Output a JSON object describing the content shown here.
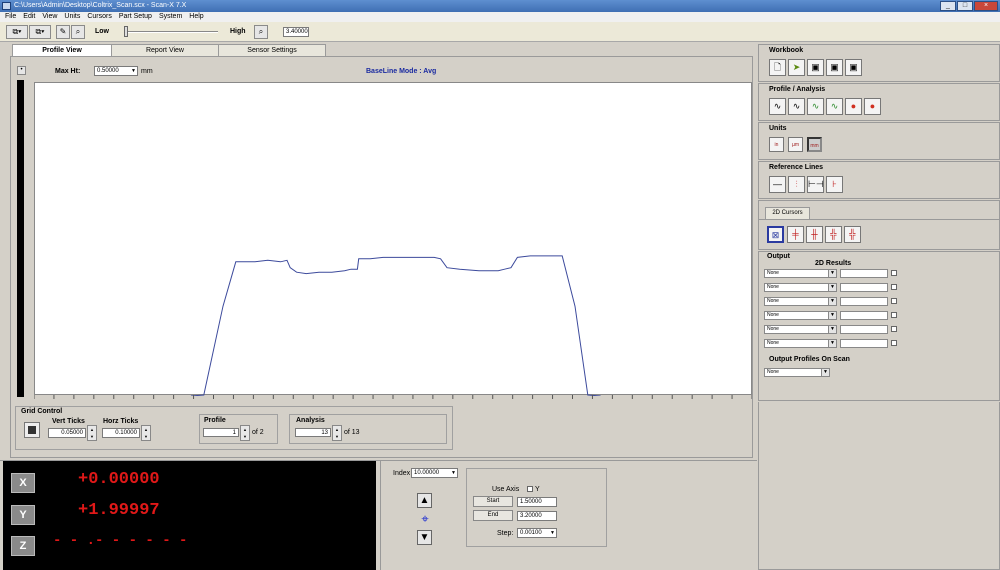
{
  "window": {
    "title": "C:\\Users\\Admin\\Desktop\\Coltrix_Scan.scx - Scan-X 7.X"
  },
  "menu": [
    "File",
    "Edit",
    "View",
    "Units",
    "Cursors",
    "Part Setup",
    "System",
    "Help"
  ],
  "toolbar": {
    "low_label": "Low",
    "high_label": "High",
    "value": "3.40000"
  },
  "tabs": [
    "Profile View",
    "Report View",
    "Sensor Settings"
  ],
  "plot_header": {
    "max_ht_label": "Max Ht:",
    "max_ht_value": "0.50000",
    "max_ht_unit": "mm",
    "baseline_mode": "BaseLine Mode : Avg"
  },
  "grid_control": {
    "title": "Grid Control",
    "vert_label": "Vert Ticks",
    "vert_value": "0.05000",
    "horz_label": "Horz Ticks",
    "horz_value": "0.10000",
    "profile_label": "Profile",
    "profile_value": "1",
    "profile_of": "of 2",
    "analysis_label": "Analysis",
    "analysis_value": "13",
    "analysis_of": "of 13"
  },
  "dro": {
    "x_label": "X",
    "x_value": "+0.00000",
    "y_label": "Y",
    "y_value": "+1.99997",
    "z_label": "Z",
    "z_value": "- - .- - - - - -"
  },
  "index_panel": {
    "index_label": "Index",
    "index_value": "10.00000",
    "use_axis_label": "Use Axis",
    "use_axis_value": "Y",
    "start_label": "Start",
    "start_value": "1.50000",
    "end_label": "End",
    "end_value": "3.20000",
    "step_label": "Step:",
    "step_value": "0.00100"
  },
  "right": {
    "workbook": "Workbook",
    "profile_analysis": "Profile / Analysis",
    "units": "Units",
    "units_buttons": [
      "in",
      "µm",
      "mm"
    ],
    "reference_lines": "Reference Lines",
    "cursors_tab": "2D Cursors",
    "output": "Output",
    "results_title": "2D Results",
    "output_rows": [
      "None",
      "None",
      "None",
      "None",
      "None",
      "None"
    ],
    "output_profiles_label": "Output Profiles On Scan",
    "output_profiles_value": "None"
  },
  "chart_data": {
    "type": "line",
    "series": [
      {
        "values": [
          [
            0.0,
            0.0
          ],
          [
            0.02,
            0.0
          ],
          [
            0.05,
            0.6
          ],
          [
            0.07,
            0.9
          ],
          [
            0.1,
            0.9
          ],
          [
            0.12,
            0.91
          ],
          [
            0.14,
            0.9
          ],
          [
            0.15,
            0.91
          ],
          [
            0.155,
            0.86
          ],
          [
            0.165,
            0.83
          ],
          [
            0.18,
            0.82
          ],
          [
            0.2,
            0.83
          ],
          [
            0.22,
            0.83
          ],
          [
            0.24,
            0.84
          ],
          [
            0.25,
            0.85
          ],
          [
            0.26,
            0.85
          ],
          [
            0.262,
            0.92
          ],
          [
            0.28,
            0.92
          ],
          [
            0.3,
            0.93
          ],
          [
            0.33,
            0.93
          ],
          [
            0.36,
            0.93
          ],
          [
            0.38,
            0.93
          ],
          [
            0.39,
            0.92
          ],
          [
            0.4,
            0.86
          ],
          [
            0.42,
            0.85
          ],
          [
            0.45,
            0.84
          ],
          [
            0.48,
            0.84
          ],
          [
            0.49,
            0.85
          ],
          [
            0.5,
            0.86
          ],
          [
            0.51,
            0.93
          ],
          [
            0.53,
            0.94
          ],
          [
            0.56,
            0.94
          ],
          [
            0.58,
            0.94
          ],
          [
            0.6,
            0.6
          ],
          [
            0.62,
            0.0
          ],
          [
            0.64,
            0.0
          ]
        ]
      }
    ],
    "grid": true
  },
  "colors": {
    "profile_line": "#3c4a9c",
    "dro_value": "#e01818",
    "dro_bg": "#000000",
    "titlebar": "#4a7cc2"
  }
}
